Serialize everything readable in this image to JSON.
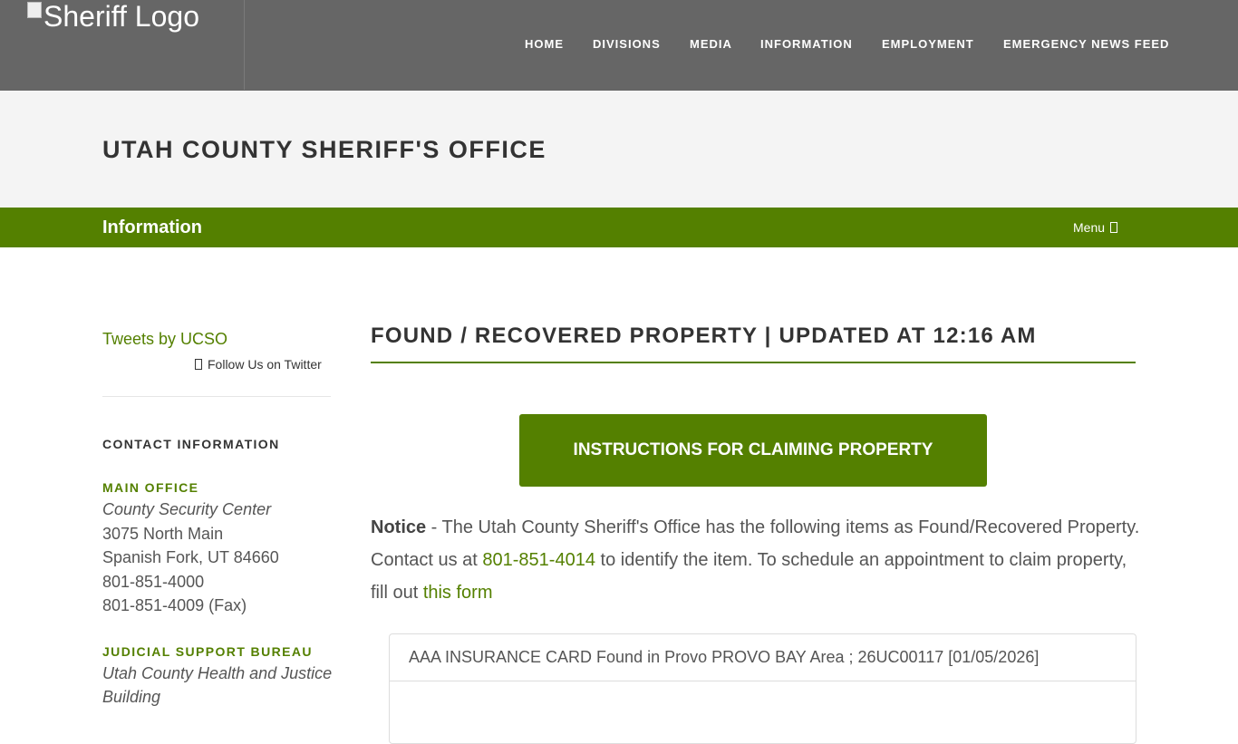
{
  "header": {
    "logo_alt": "Sheriff Logo",
    "nav": [
      "HOME",
      "DIVISIONS",
      "MEDIA",
      "INFORMATION",
      "EMPLOYMENT",
      "EMERGENCY NEWS FEED"
    ]
  },
  "site_title": "UTAH COUNTY SHERIFF'S OFFICE",
  "section_bar": {
    "name": "Information",
    "menu_label": "Menu"
  },
  "sidebar": {
    "tweets_link": "Tweets by UCSO",
    "follow_link": "Follow Us on Twitter",
    "contact_heading": "CONTACT INFORMATION",
    "offices": [
      {
        "name": "MAIN OFFICE",
        "building": "County Security Center",
        "street": "3075 North Main",
        "city": "Spanish Fork, UT 84660",
        "phone": "801-851-4000",
        "fax": "801-851-4009 (Fax)"
      },
      {
        "name": "JUDICIAL SUPPORT BUREAU",
        "building_line1": "Utah County Health and Justice",
        "building_line2": "Building"
      }
    ]
  },
  "main": {
    "heading": "FOUND / RECOVERED PROPERTY | UPDATED AT 12:16 AM",
    "claim_button": "INSTRUCTIONS FOR CLAIMING PROPERTY",
    "notice": {
      "label": "Notice",
      "text1": " - The Utah County Sheriff's Office has the following items as Found/Recovered Property. Contact us at ",
      "phone": "801-851-4014",
      "text2": " to identify the item. To schedule an appointment to claim property, fill out ",
      "form_link": "this form"
    },
    "items": [
      "AAA INSURANCE CARD Found in Provo PROVO BAY Area ; 26UC00117 [01/05/2026]"
    ]
  },
  "colors": {
    "nav_bg": "#666666",
    "title_band_bg": "#f4f4f4",
    "accent_green": "#548000"
  }
}
